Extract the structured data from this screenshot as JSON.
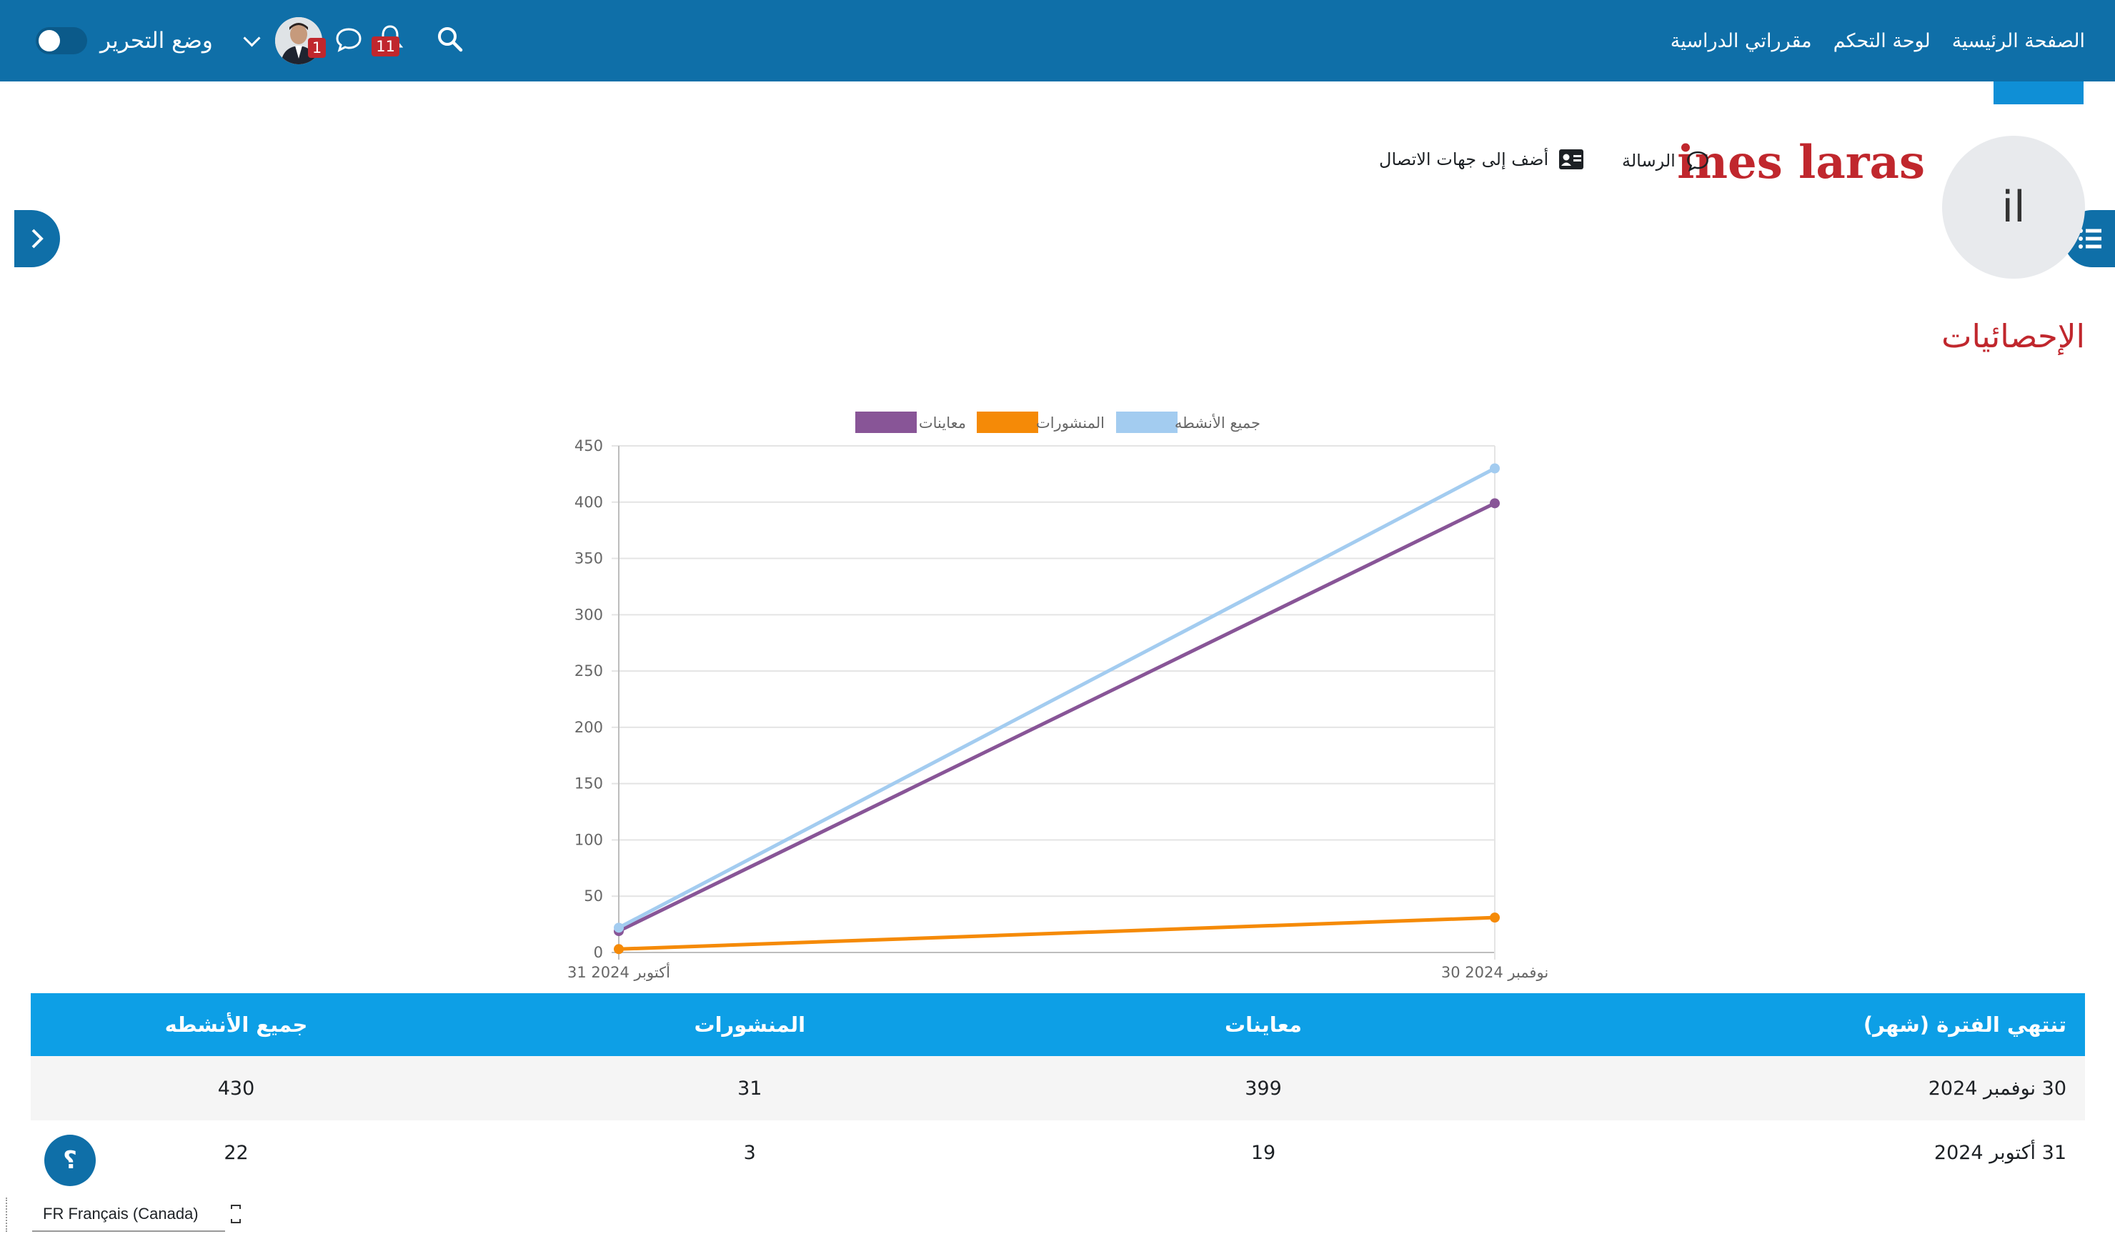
{
  "nav": {
    "links": [
      "الصفحة الرئيسية",
      "لوحة التحكم",
      "مقرراتي الدراسية"
    ],
    "edit_mode_label": "وضع التحرير",
    "messages_badge": "1",
    "notifications_badge": "11",
    "icons": [
      "search-icon",
      "bell-icon",
      "message-icon",
      "chevron-down-icon"
    ],
    "color": "#0f6fa8"
  },
  "profile": {
    "initials": "il",
    "name": "ines laras",
    "message_label": "الرسالة",
    "add_contact_label": "أضف إلى جهات الاتصال"
  },
  "section_title": "الإحصائيات",
  "chart_data": {
    "type": "line",
    "categories": [
      "31 أكتوبر 2024",
      "30 نوفمبر 2024"
    ],
    "series": [
      {
        "name": "معاينات",
        "values": [
          19,
          399
        ],
        "color": "#885597"
      },
      {
        "name": "المنشورات",
        "values": [
          3,
          31
        ],
        "color": "#f58a07"
      },
      {
        "name": "جميع الأنشطه",
        "values": [
          22,
          430
        ],
        "color": "#a3ccf0"
      }
    ],
    "yticks": [
      "0",
      "50",
      "100",
      "150",
      "200",
      "250",
      "300",
      "350",
      "400",
      "450"
    ],
    "ylim": [
      0,
      450
    ],
    "grid": true,
    "legend": "top-center"
  },
  "table": {
    "headers": [
      "تنتهي الفترة (شهر)",
      "معاينات",
      "المنشورات",
      "جميع الأنشطه"
    ],
    "rows": [
      [
        "30 نوفمبر 2024",
        "399",
        "31",
        "430"
      ],
      [
        "31 أكتوبر 2024",
        "19",
        "3",
        "22"
      ]
    ]
  },
  "help_label": "؟",
  "footer": {
    "language": "FR Français (Canada)"
  }
}
